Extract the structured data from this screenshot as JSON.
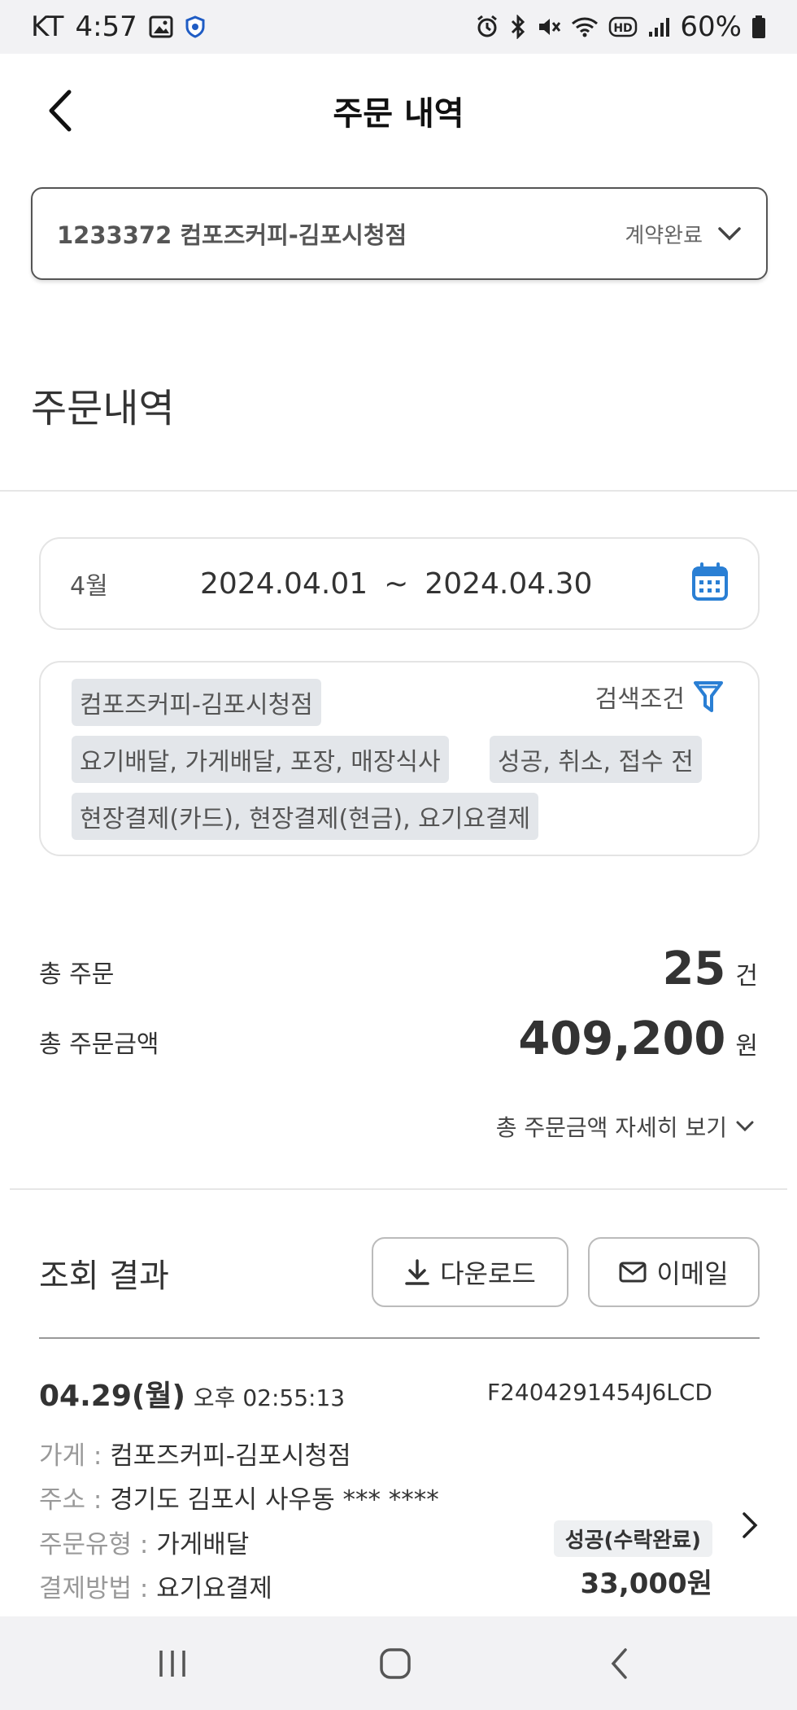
{
  "status_bar": {
    "carrier": "KT",
    "time": "4:57",
    "battery": "60%",
    "icons": [
      "image-icon",
      "shield-icon",
      "alarm-icon",
      "bluetooth-icon",
      "mute-icon",
      "wifi-icon",
      "hd-icon",
      "signal-icon",
      "battery-icon"
    ]
  },
  "header": {
    "title": "주문 내역"
  },
  "store": {
    "name": "1233372 컴포즈커피-김포시청점",
    "status": "계약완료"
  },
  "section_title": "주문내역",
  "date_filter": {
    "month": "4월",
    "start": "2024.04.01",
    "separator": "~",
    "end": "2024.04.30"
  },
  "filters": {
    "label": "검색조건",
    "chips": [
      "컴포즈커피-김포시청점",
      "요기배달, 가게배달, 포장, 매장식사",
      "성공, 취소, 접수 전",
      "현장결제(카드), 현장결제(현금), 요기요결제"
    ]
  },
  "totals": {
    "orders_label": "총 주문",
    "orders_value": "25",
    "orders_unit": "건",
    "amount_label": "총 주문금액",
    "amount_value": "409,200",
    "amount_unit": "원",
    "detail_link": "총 주문금액 자세히 보기"
  },
  "results": {
    "title": "조회 결과",
    "download_label": "다운로드",
    "email_label": "이메일"
  },
  "order": {
    "date": "04.29(월)",
    "time": "오후 02:55:13",
    "id": "F2404291454J6LCD",
    "store_key": "가게 :",
    "store_value": "컴포즈커피-김포시청점",
    "address_key": "주소 :",
    "address_value": "경기도 김포시 사우동 *** ****",
    "type_key": "주문유형 :",
    "type_value": "가게배달",
    "payment_key": "결제방법 :",
    "payment_value": "요기요결제",
    "status": "성공(수락완료)",
    "amount": "33,000원"
  },
  "colors": {
    "accent": "#2a7fd4",
    "chip_bg": "#e3e6ea",
    "statusbar_bg": "#f2f2f4"
  }
}
